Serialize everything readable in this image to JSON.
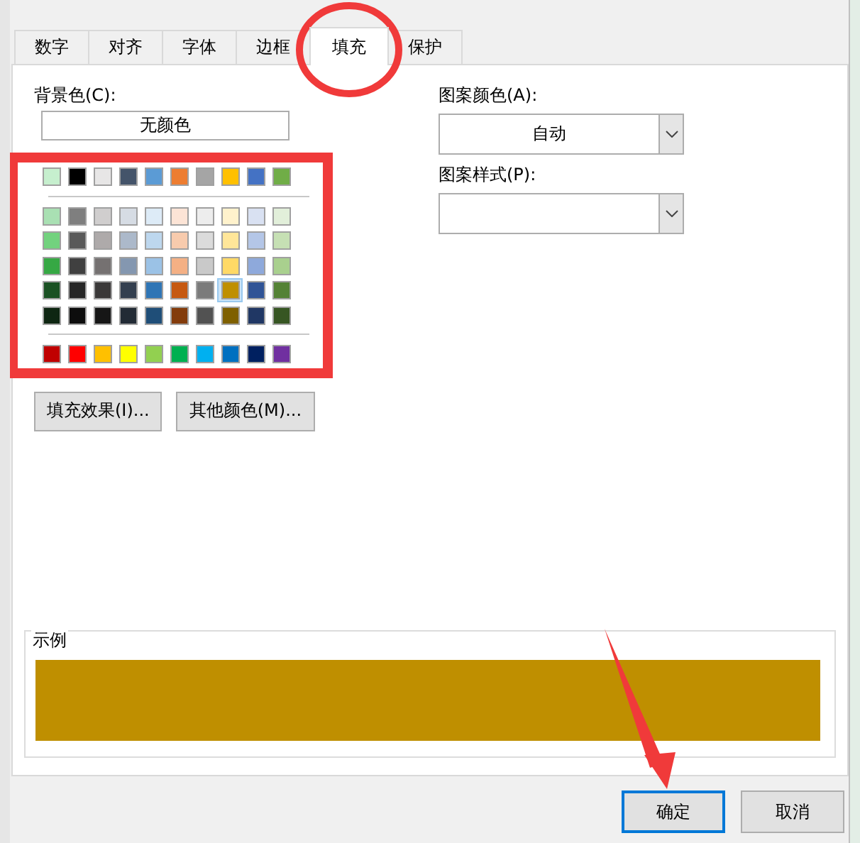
{
  "tabs": [
    {
      "label": "数字",
      "selected": false
    },
    {
      "label": "对齐",
      "selected": false
    },
    {
      "label": "字体",
      "selected": false
    },
    {
      "label": "边框",
      "selected": false
    },
    {
      "label": "填充",
      "selected": true
    },
    {
      "label": "保护",
      "selected": false
    }
  ],
  "background": {
    "label": "背景色(C):",
    "no_color_button": "无颜色",
    "theme_colors": [
      {
        "color": "#c6efce",
        "selected": false
      },
      {
        "color": "#000000",
        "selected": false
      },
      {
        "color": "#e7e6e6",
        "selected": false
      },
      {
        "color": "#44546a",
        "selected": false
      },
      {
        "color": "#5b9bd5",
        "selected": false
      },
      {
        "color": "#ed7d31",
        "selected": false
      },
      {
        "color": "#a5a5a5",
        "selected": false
      },
      {
        "color": "#ffc000",
        "selected": false
      },
      {
        "color": "#4472c4",
        "selected": false
      },
      {
        "color": "#70ad47",
        "selected": false
      }
    ],
    "tint_rows": [
      {
        "swatches": [
          {
            "color": "#a9e0b3",
            "selected": false
          },
          {
            "color": "#7f7f7f",
            "selected": false
          },
          {
            "color": "#d0cece",
            "selected": false
          },
          {
            "color": "#d6dce4",
            "selected": false
          },
          {
            "color": "#ddebf7",
            "selected": false
          },
          {
            "color": "#fce4d6",
            "selected": false
          },
          {
            "color": "#ededed",
            "selected": false
          },
          {
            "color": "#fff2cc",
            "selected": false
          },
          {
            "color": "#d9e1f2",
            "selected": false
          },
          {
            "color": "#e2efda",
            "selected": false
          }
        ]
      },
      {
        "swatches": [
          {
            "color": "#72d27e",
            "selected": false
          },
          {
            "color": "#595959",
            "selected": false
          },
          {
            "color": "#aeaaaa",
            "selected": false
          },
          {
            "color": "#acb9ca",
            "selected": false
          },
          {
            "color": "#bdd7ee",
            "selected": false
          },
          {
            "color": "#f8cbad",
            "selected": false
          },
          {
            "color": "#dbdbdb",
            "selected": false
          },
          {
            "color": "#ffe699",
            "selected": false
          },
          {
            "color": "#b4c6e7",
            "selected": false
          },
          {
            "color": "#c6e0b4",
            "selected": false
          }
        ]
      },
      {
        "swatches": [
          {
            "color": "#36a844",
            "selected": false
          },
          {
            "color": "#404040",
            "selected": false
          },
          {
            "color": "#757171",
            "selected": false
          },
          {
            "color": "#8497b0",
            "selected": false
          },
          {
            "color": "#9bc2e6",
            "selected": false
          },
          {
            "color": "#f4b084",
            "selected": false
          },
          {
            "color": "#c9c9c9",
            "selected": false
          },
          {
            "color": "#ffd966",
            "selected": false
          },
          {
            "color": "#8ea9db",
            "selected": false
          },
          {
            "color": "#a9d08e",
            "selected": false
          }
        ]
      },
      {
        "swatches": [
          {
            "color": "#1a5123",
            "selected": false
          },
          {
            "color": "#262626",
            "selected": false
          },
          {
            "color": "#3a3838",
            "selected": false
          },
          {
            "color": "#333f4f",
            "selected": false
          },
          {
            "color": "#2f75b5",
            "selected": false
          },
          {
            "color": "#c65911",
            "selected": false
          },
          {
            "color": "#7b7b7b",
            "selected": false
          },
          {
            "color": "#bf8f00",
            "selected": true
          },
          {
            "color": "#305496",
            "selected": false
          },
          {
            "color": "#548235",
            "selected": false
          }
        ]
      },
      {
        "swatches": [
          {
            "color": "#0e2612",
            "selected": false
          },
          {
            "color": "#0d0d0d",
            "selected": false
          },
          {
            "color": "#161616",
            "selected": false
          },
          {
            "color": "#222b35",
            "selected": false
          },
          {
            "color": "#1f4e78",
            "selected": false
          },
          {
            "color": "#833c0c",
            "selected": false
          },
          {
            "color": "#525252",
            "selected": false
          },
          {
            "color": "#7f6000",
            "selected": false
          },
          {
            "color": "#203764",
            "selected": false
          },
          {
            "color": "#375623",
            "selected": false
          }
        ]
      }
    ],
    "standard_colors": [
      {
        "color": "#c00000",
        "selected": false
      },
      {
        "color": "#ff0000",
        "selected": false
      },
      {
        "color": "#ffc000",
        "selected": false
      },
      {
        "color": "#ffff00",
        "selected": false
      },
      {
        "color": "#92d050",
        "selected": false
      },
      {
        "color": "#00b050",
        "selected": false
      },
      {
        "color": "#00b0f0",
        "selected": false
      },
      {
        "color": "#0070c0",
        "selected": false
      },
      {
        "color": "#002060",
        "selected": false
      },
      {
        "color": "#7030a0",
        "selected": false
      }
    ],
    "buttons": [
      "填充效果(I)...",
      "其他颜色(M)..."
    ]
  },
  "pattern_color": {
    "label": "图案颜色(A):",
    "value": "自动"
  },
  "pattern_style": {
    "label": "图案样式(P):"
  },
  "sample": {
    "label": "示例",
    "color": "#bf8f00"
  },
  "buttons": [
    {
      "label": "确定",
      "default": true
    },
    {
      "label": "取消",
      "default": false
    }
  ],
  "annotations": [
    {
      "kind": "ellipse"
    },
    {
      "kind": "rectangle"
    },
    {
      "kind": "arrow"
    }
  ]
}
